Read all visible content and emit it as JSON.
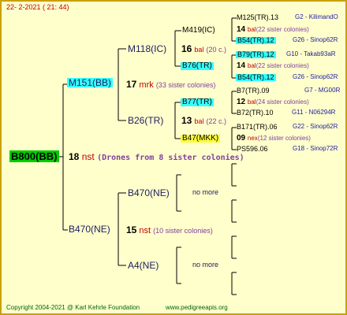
{
  "header": {
    "date": "22-  2-2021 ( 21: 44)"
  },
  "footer": {
    "copyright": "Copyright 2004-2021 @ Karl Kehrle Foundation",
    "url": "www.pedigreeapis.org"
  },
  "colors": {
    "background": "#ffffcc",
    "border": "#c8a000",
    "root_highlight": "#00cc00",
    "cyan_highlight": "#33ffff",
    "yellow_highlight": "#ffff33",
    "red_text": "#c00000",
    "blue_text": "#2020a0"
  },
  "root": {
    "id": "B800(BB)"
  },
  "gen1": {
    "top": {
      "id": "M151(BB)",
      "drones": "17",
      "drone_label": "mrk",
      "sisters": "(33 sister colonies)"
    },
    "root_drones": {
      "count": "18",
      "label": "nst",
      "note": "(Drones from 8 sister colonies)"
    },
    "bottom": {
      "id": "B470(NE)",
      "drones": "15",
      "drone_label": "nst",
      "sisters": "(10 sister colonies)"
    }
  },
  "gen2": {
    "m118": {
      "id": "M118(IC)",
      "drones": "16",
      "drone_label": "bal",
      "sisters": "(20 c.)"
    },
    "b26": {
      "id": "B26(TR)",
      "drones": "13",
      "drone_label": "bal",
      "sisters": "(22 c.)"
    },
    "b470ne": {
      "id": "B470(NE)",
      "more": "no more"
    },
    "a4": {
      "id": "A4(NE)",
      "more": "no more"
    }
  },
  "gen3": {
    "m419": {
      "id": "M419(IC)",
      "drones": "14",
      "drone_label": "bal",
      "sisters": "(22 sister colonies)"
    },
    "b76": {
      "id": "B76(TR)",
      "drones": "14",
      "drone_label": "bal",
      "sisters": "(22 sister colonies)"
    },
    "b77": {
      "id": "B77(TR)",
      "drones": "12",
      "drone_label": "bal",
      "sisters": "(24 sister colonies)"
    },
    "b47": {
      "id": "B47(MKK)",
      "drones": "09",
      "drone_label": "nex",
      "sisters": "(12 sister colonies)"
    }
  },
  "gen4": [
    {
      "id": "M125(TR).13",
      "group": "G2 - KilimandO"
    },
    {
      "id": "B54(TR).12",
      "group": "G26 - Sinop62R"
    },
    {
      "id": "B79(TR).12",
      "group": "G10 - Takab93aR"
    },
    {
      "id": "B54(TR).12",
      "group": "G26 - Sinop62R"
    },
    {
      "id": "B7(TR).09",
      "group": "G7 - MG00R"
    },
    {
      "id": "B72(TR).10",
      "group": "G11 - N06294R"
    },
    {
      "id": "B171(TR).06",
      "group": "G22 - Sinop62R"
    },
    {
      "id": "PS596.06",
      "group": "G18 - Sinop72R"
    }
  ]
}
